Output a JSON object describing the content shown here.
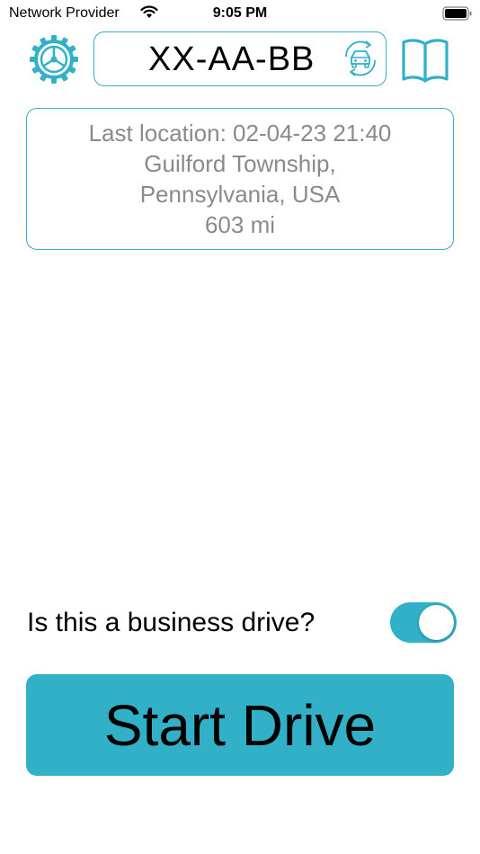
{
  "status_bar": {
    "carrier": "Network Provider",
    "time": "9:05 PM"
  },
  "header": {
    "plate": "XX-AA-BB",
    "settings_icon": "gear-icon",
    "swap_icon": "car-swap-icon",
    "logbook_icon": "open-book-icon"
  },
  "location": {
    "line1": "Last location: 02-04-23 21:40",
    "line2": "Guilford Township,",
    "line3": "Pennsylvania, USA",
    "line4": "603 mi"
  },
  "business": {
    "question": "Is this a business drive?",
    "enabled": true
  },
  "start_button": {
    "label": "Start Drive"
  },
  "colors": {
    "accent": "#31b0c7",
    "muted_text": "#8a8a8a"
  }
}
